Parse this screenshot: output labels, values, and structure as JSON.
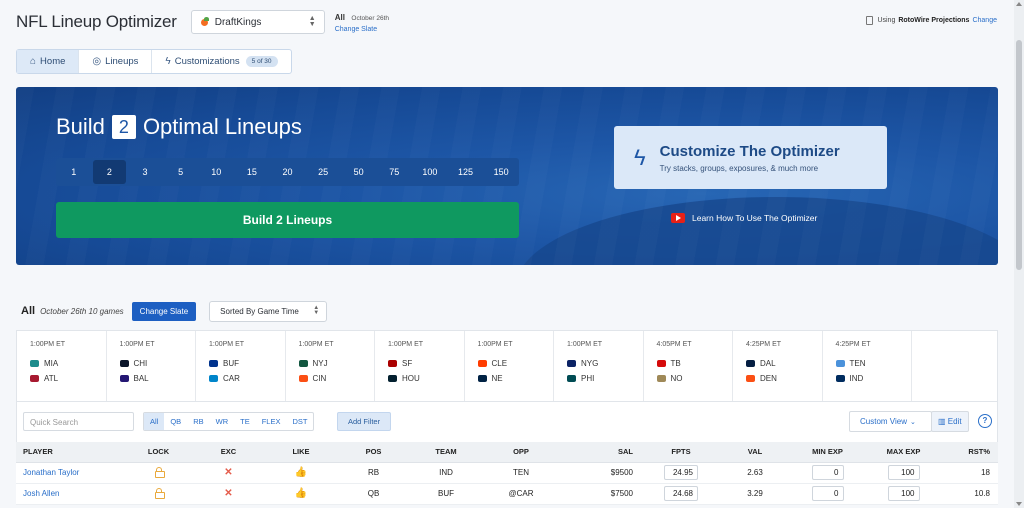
{
  "header": {
    "title": "NFL Lineup Optimizer",
    "site": "DraftKings",
    "slate_label": "All",
    "slate_date": "October 26th",
    "change_slate": "Change Slate",
    "projections_prefix": "Using",
    "projections_source": "RotoWire Projections",
    "projections_change": "Change"
  },
  "tabs": [
    {
      "label": "Home",
      "icon": "home-icon"
    },
    {
      "label": "Lineups",
      "icon": "lineups-icon"
    },
    {
      "label": "Customizations",
      "icon": "bolt-icon",
      "badge": "5 of 30"
    }
  ],
  "hero": {
    "build_word": "Build",
    "build_count": "2",
    "build_suffix": "Optimal Lineups",
    "counts": [
      "1",
      "2",
      "3",
      "5",
      "10",
      "15",
      "20",
      "25",
      "50",
      "75",
      "100",
      "125",
      "150"
    ],
    "selected_count": "2",
    "build_button": "Build 2 Lineups",
    "customize_title": "Customize The Optimizer",
    "customize_sub": "Try stacks, groups, exposures, & much more",
    "learn_link": "Learn How To Use The Optimizer"
  },
  "slate_bar": {
    "all": "All",
    "meta": "October 26th  10 games",
    "change": "Change Slate",
    "sort": "Sorted By Game Time"
  },
  "games": [
    {
      "time": "1:00PM ET",
      "away": "MIA",
      "home": "ATL",
      "away_color": "#1d8c8c",
      "home_color": "#a71930"
    },
    {
      "time": "1:00PM ET",
      "away": "CHI",
      "home": "BAL",
      "away_color": "#0b162a",
      "home_color": "#241773"
    },
    {
      "time": "1:00PM ET",
      "away": "BUF",
      "home": "CAR",
      "away_color": "#00338d",
      "home_color": "#0085ca"
    },
    {
      "time": "1:00PM ET",
      "away": "NYJ",
      "home": "CIN",
      "away_color": "#125740",
      "home_color": "#fb4f14"
    },
    {
      "time": "1:00PM ET",
      "away": "SF",
      "home": "HOU",
      "away_color": "#aa0000",
      "home_color": "#03202f"
    },
    {
      "time": "1:00PM ET",
      "away": "CLE",
      "home": "NE",
      "away_color": "#ff3c00",
      "home_color": "#002244"
    },
    {
      "time": "1:00PM ET",
      "away": "NYG",
      "home": "PHI",
      "away_color": "#0b2265",
      "home_color": "#004c54"
    },
    {
      "time": "4:05PM ET",
      "away": "TB",
      "home": "NO",
      "away_color": "#d50a0a",
      "home_color": "#9f8958"
    },
    {
      "time": "4:25PM ET",
      "away": "DAL",
      "home": "DEN",
      "away_color": "#041e42",
      "home_color": "#fb4f14"
    },
    {
      "time": "4:25PM ET",
      "away": "TEN",
      "home": "IND",
      "away_color": "#4b92db",
      "home_color": "#002c5f"
    }
  ],
  "filters": {
    "search_placeholder": "Quick Search",
    "positions": [
      "All",
      "QB",
      "RB",
      "WR",
      "TE",
      "FLEX",
      "DST"
    ],
    "active_position": "All",
    "add_filter": "Add Filter",
    "custom_view": "Custom View",
    "edit": "Edit",
    "help": "?"
  },
  "table": {
    "columns": [
      "PLAYER",
      "LOCK",
      "EXC",
      "LIKE",
      "POS",
      "TEAM",
      "OPP",
      "SAL",
      "FPTS",
      "VAL",
      "MIN EXP",
      "MAX EXP",
      "RST%"
    ],
    "rows": [
      {
        "player": "Jonathan Taylor",
        "pos": "RB",
        "team": "IND",
        "opp": "TEN",
        "sal": "$9500",
        "fpts": "24.95",
        "val": "2.63",
        "min_exp": "0",
        "max_exp": "100",
        "rst": "18"
      },
      {
        "player": "Josh Allen",
        "pos": "QB",
        "team": "BUF",
        "opp": "@CAR",
        "sal": "$7500",
        "fpts": "24.68",
        "val": "3.29",
        "min_exp": "0",
        "max_exp": "100",
        "rst": "10.8"
      }
    ]
  },
  "colors": {
    "accent": "#2a6fc9",
    "build_green": "#0f9960",
    "hero_blue": "#1d56a6"
  }
}
